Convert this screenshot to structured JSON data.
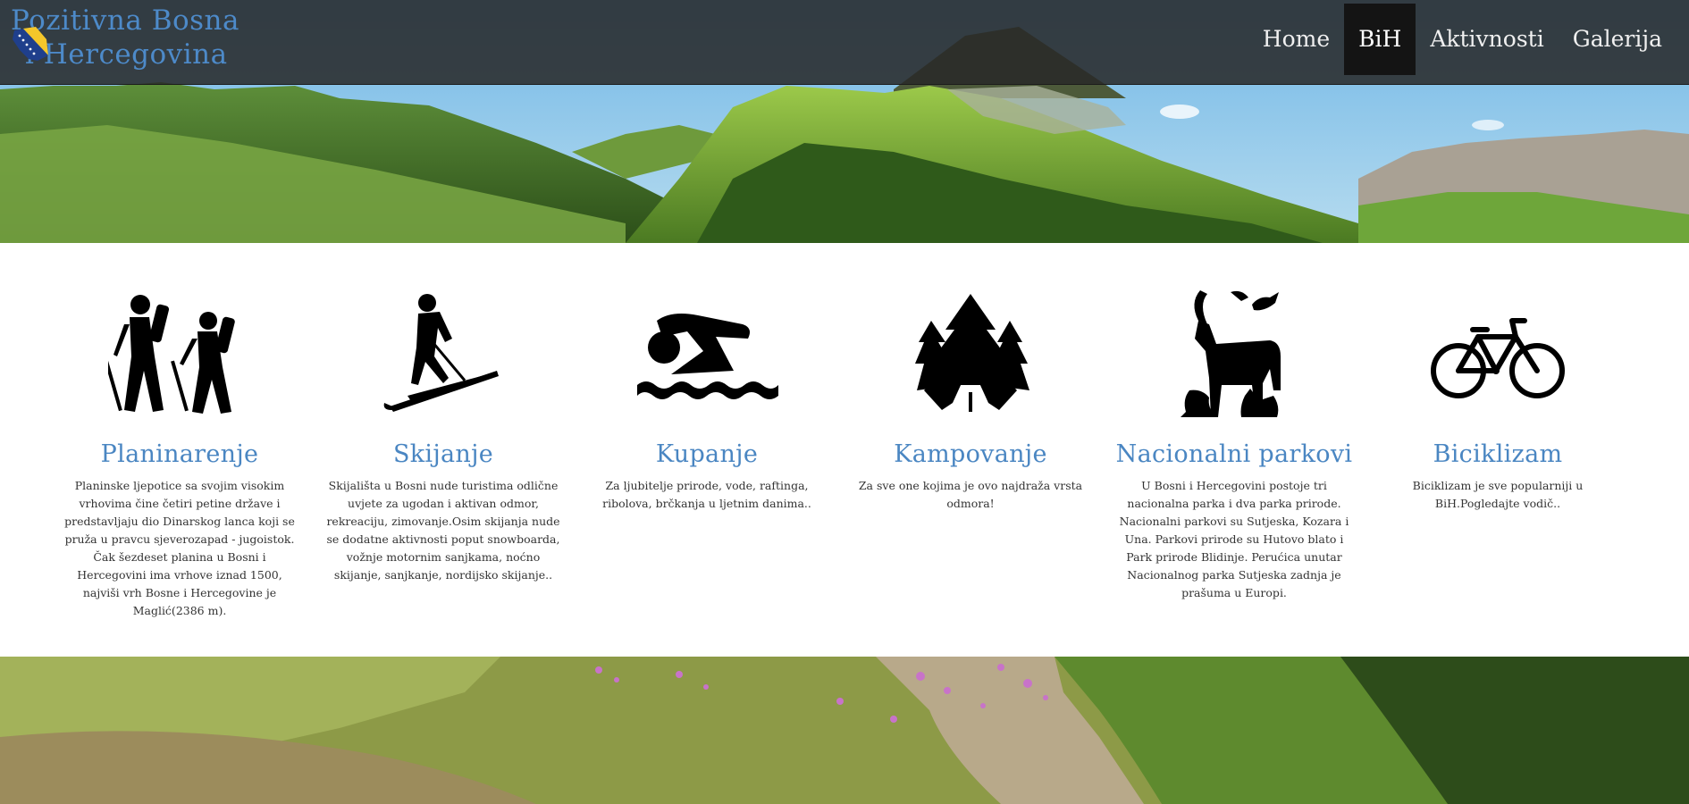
{
  "brand": {
    "title_line1": "Pozitivna Bosna",
    "title_line2": "i Hercegovina",
    "logo_icon": "bih-map-flag-icon"
  },
  "nav": {
    "items": [
      {
        "label": "Home",
        "active": false
      },
      {
        "label": "BiH",
        "active": true
      },
      {
        "label": "Aktivnosti",
        "active": false
      },
      {
        "label": "Galerija",
        "active": false
      }
    ]
  },
  "colors": {
    "accent": "#4a86c2",
    "navbar_bg": "#282828",
    "nav_active_bg": "#141414"
  },
  "features": [
    {
      "icon": "hikers-icon",
      "title": "Planinarenje",
      "text": "Planinske ljepotice sa svojim visokim vrhovima čine četiri petine države i predstavljaju dio Dinarskog lanca koji se pruža u pravcu sjeverozapad - jugoistok. Čak šezdeset planina u Bosni i Hercegovini ima vrhove iznad 1500, najviši vrh Bosne i Hercegovine je Maglić(2386 m)."
    },
    {
      "icon": "skier-icon",
      "title": "Skijanje",
      "text": "Skijališta u Bosni nude turistima odlične uvjete za ugodan i aktivan odmor, rekreaciju, zimovanje.Osim skijanja nude se dodatne aktivnosti poput snowboarda, vožnje motornim sanjkama, noćno skijanje, sanjkanje, nordijsko skijanje.."
    },
    {
      "icon": "swimmer-icon",
      "title": "Kupanje",
      "text": "Za ljubitelje prirode, vode, raftinga, ribolova, brčkanja u ljetnim danima.."
    },
    {
      "icon": "tent-trees-icon",
      "title": "Kampovanje",
      "text": "Za sve one kojima je ovo najdraža vrsta odmora!"
    },
    {
      "icon": "wildlife-icon",
      "title": "Nacionalni parkovi",
      "text": "U Bosni i Hercegovini postoje tri nacionalna parka i dva parka prirode. Nacionalni parkovi su Sutjeska, Kozara i Una. Parkovi prirode su Hutovo blato i Park prirode Blidinje. Perućica unutar Nacionalnog parka Sutjeska zadnja je prašuma u Europi."
    },
    {
      "icon": "bicycle-icon",
      "title": "Biciklizam",
      "text": "Biciklizam je sve popularniji u BiH.Pogledajte vodič.."
    }
  ]
}
